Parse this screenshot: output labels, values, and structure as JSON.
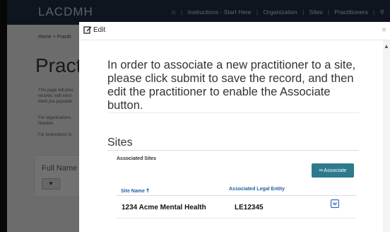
{
  "nav": {
    "brand": "LACDMH",
    "links": [
      "Instructions - Start Here",
      "Organization",
      "Sites",
      "Practitioners"
    ],
    "home_icon": "home-icon",
    "search_icon": "search-icon"
  },
  "background": {
    "breadcrumb": "Home > Practit",
    "title": "Practit",
    "para1": "This page will pres records, edit exist them pre-populate",
    "para2": "For organizations Number.",
    "para3": "For instructions fo",
    "filter_label": "Full Name",
    "filter_button_icon": "filter-icon"
  },
  "modal": {
    "title": "Edit",
    "edit_icon": "edit-icon",
    "close_icon": "close-icon",
    "message": "In order to associate a new practitioner to a site, please click submit to save the record, and then edit the practitioner to enable the Associate button.",
    "sites_heading": "Sites",
    "associated_sites_label": "Associated Sites",
    "associate_button": "Associate",
    "table": {
      "columns": [
        {
          "label": "Site Name",
          "sorted": "ascending"
        },
        {
          "label": "Associated Legal Entity"
        }
      ],
      "rows": [
        {
          "site_name": "1234 Acme Mental Health",
          "legal_entity": "LE12345"
        }
      ]
    }
  },
  "colors": {
    "navbar": "#1c2a3e",
    "accent_button": "#2d7a8c",
    "link_blue": "#2461a8"
  }
}
